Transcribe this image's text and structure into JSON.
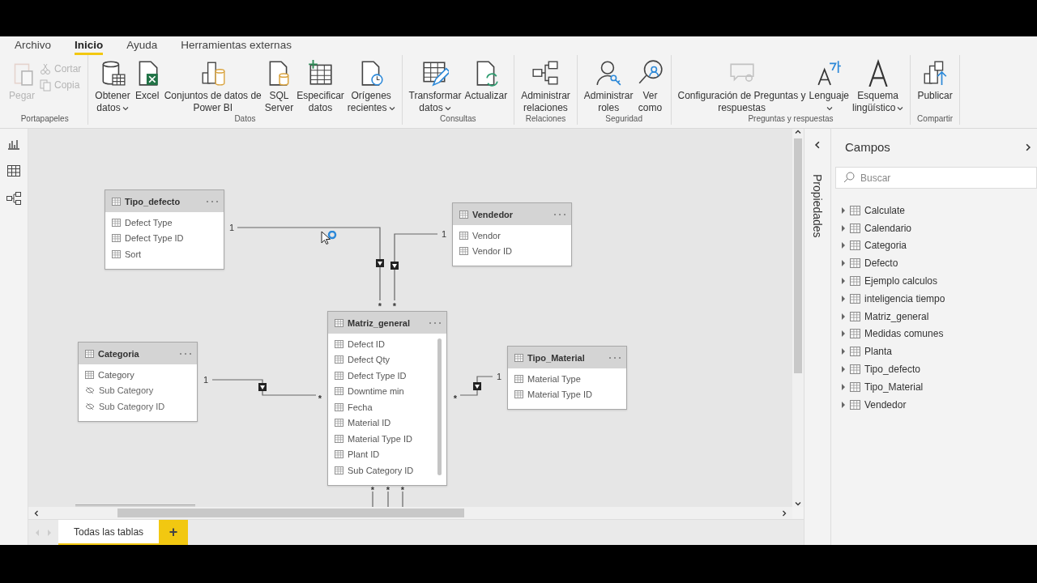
{
  "menu_tabs": [
    {
      "label": "Archivo",
      "selected": false
    },
    {
      "label": "Inicio",
      "selected": true
    },
    {
      "label": "Ayuda",
      "selected": false
    },
    {
      "label": "Herramientas externas",
      "selected": false
    }
  ],
  "ribbon_groups": [
    {
      "label": "Portapapeles",
      "buttons": [
        {
          "kind": "large",
          "lines": [
            "Pegar"
          ],
          "dropdown": false,
          "disabled": true
        },
        {
          "kind": "small",
          "lines": [
            "Cortar"
          ],
          "dropdown": false,
          "disabled": true
        },
        {
          "kind": "small",
          "lines": [
            "Copia"
          ],
          "dropdown": false,
          "disabled": true
        }
      ]
    },
    {
      "label": "Datos",
      "buttons": [
        {
          "kind": "large",
          "lines": [
            "Obtener",
            "datos"
          ],
          "dropdown": true,
          "disabled": false
        },
        {
          "kind": "large",
          "lines": [
            "Excel"
          ],
          "dropdown": false,
          "disabled": false
        },
        {
          "kind": "large",
          "lines": [
            "Conjuntos de datos de",
            "Power BI"
          ],
          "dropdown": false,
          "disabled": false
        },
        {
          "kind": "large",
          "lines": [
            "SQL",
            "Server"
          ],
          "dropdown": false,
          "disabled": false
        },
        {
          "kind": "large",
          "lines": [
            "Especificar",
            "datos"
          ],
          "dropdown": false,
          "disabled": false
        },
        {
          "kind": "large",
          "lines": [
            "Orígenes",
            "recientes"
          ],
          "dropdown": true,
          "disabled": false
        }
      ]
    },
    {
      "label": "Consultas",
      "buttons": [
        {
          "kind": "large",
          "lines": [
            "Transformar",
            "datos"
          ],
          "dropdown": true,
          "disabled": false
        },
        {
          "kind": "large",
          "lines": [
            "Actualizar"
          ],
          "dropdown": false,
          "disabled": false
        }
      ]
    },
    {
      "label": "Relaciones",
      "buttons": [
        {
          "kind": "large",
          "lines": [
            "Administrar",
            "relaciones"
          ],
          "dropdown": false,
          "disabled": false
        }
      ]
    },
    {
      "label": "Seguridad",
      "buttons": [
        {
          "kind": "large",
          "lines": [
            "Administrar",
            "roles"
          ],
          "dropdown": false,
          "disabled": false
        },
        {
          "kind": "large",
          "lines": [
            "Ver",
            "como"
          ],
          "dropdown": false,
          "disabled": false
        }
      ]
    },
    {
      "label": "Preguntas y respuestas",
      "buttons": [
        {
          "kind": "large",
          "lines": [
            "Configuración de Preguntas y",
            "respuestas"
          ],
          "dropdown": false,
          "disabled": false
        },
        {
          "kind": "large",
          "lines": [
            "Lenguaje"
          ],
          "dropdown": true,
          "disabled": false
        },
        {
          "kind": "large",
          "lines": [
            "Esquema",
            "lingüístico"
          ],
          "dropdown": true,
          "disabled": false
        }
      ]
    },
    {
      "label": "Compartir",
      "buttons": [
        {
          "kind": "large",
          "lines": [
            "Publicar"
          ],
          "dropdown": false,
          "disabled": false
        }
      ]
    }
  ],
  "diagram": {
    "tables": [
      {
        "name": "Tipo_defecto",
        "scrollable": false,
        "fields": [
          {
            "name": "Defect Type",
            "hidden": false
          },
          {
            "name": "Defect Type ID",
            "hidden": false
          },
          {
            "name": "Sort",
            "hidden": false
          }
        ]
      },
      {
        "name": "Vendedor",
        "scrollable": false,
        "fields": [
          {
            "name": "Vendor",
            "hidden": false
          },
          {
            "name": "Vendor ID",
            "hidden": false
          }
        ]
      },
      {
        "name": "Matriz_general",
        "scrollable": true,
        "fields": [
          {
            "name": "Defect ID",
            "hidden": false
          },
          {
            "name": "Defect Qty",
            "hidden": false
          },
          {
            "name": "Defect Type ID",
            "hidden": false
          },
          {
            "name": "Downtime min",
            "hidden": false
          },
          {
            "name": "Fecha",
            "hidden": false
          },
          {
            "name": "Material ID",
            "hidden": false
          },
          {
            "name": "Material Type ID",
            "hidden": false
          },
          {
            "name": "Plant ID",
            "hidden": false
          },
          {
            "name": "Sub Category ID",
            "hidden": false
          }
        ]
      },
      {
        "name": "Categoria",
        "scrollable": false,
        "fields": [
          {
            "name": "Category",
            "hidden": false
          },
          {
            "name": "Sub Category",
            "hidden": true
          },
          {
            "name": "Sub Category ID",
            "hidden": true
          }
        ]
      },
      {
        "name": "Tipo_Material",
        "scrollable": false,
        "fields": [
          {
            "name": "Material Type",
            "hidden": false
          },
          {
            "name": "Material Type ID",
            "hidden": false
          }
        ]
      }
    ],
    "relationships": [
      {
        "one": "1",
        "many": "*"
      },
      {
        "one": "1",
        "many": "*"
      },
      {
        "one": "1",
        "many": "*"
      },
      {
        "one": "1",
        "many": "*"
      },
      {
        "many": "*"
      },
      {
        "many": "*"
      },
      {
        "many": "*"
      }
    ]
  },
  "pages": [
    {
      "label": "Todas las tablas",
      "selected": true
    }
  ],
  "add_page": "+",
  "properties_pane": {
    "title": "Propiedades"
  },
  "fields_pane": {
    "title": "Campos",
    "search": {
      "placeholder": "Buscar"
    },
    "tables": [
      {
        "name": "Calculate",
        "expanded": false
      },
      {
        "name": "Calendario",
        "expanded": false
      },
      {
        "name": "Categoria",
        "expanded": false
      },
      {
        "name": "Defecto",
        "expanded": false
      },
      {
        "name": "Ejemplo calculos",
        "expanded": false
      },
      {
        "name": "inteligencia tiempo",
        "expanded": false
      },
      {
        "name": "Matriz_general",
        "expanded": false
      },
      {
        "name": "Medidas comunes",
        "expanded": false
      },
      {
        "name": "Planta",
        "expanded": false
      },
      {
        "name": "Tipo_defecto",
        "expanded": false
      },
      {
        "name": "Tipo_Material",
        "expanded": false
      },
      {
        "name": "Vendedor",
        "expanded": false
      }
    ]
  }
}
